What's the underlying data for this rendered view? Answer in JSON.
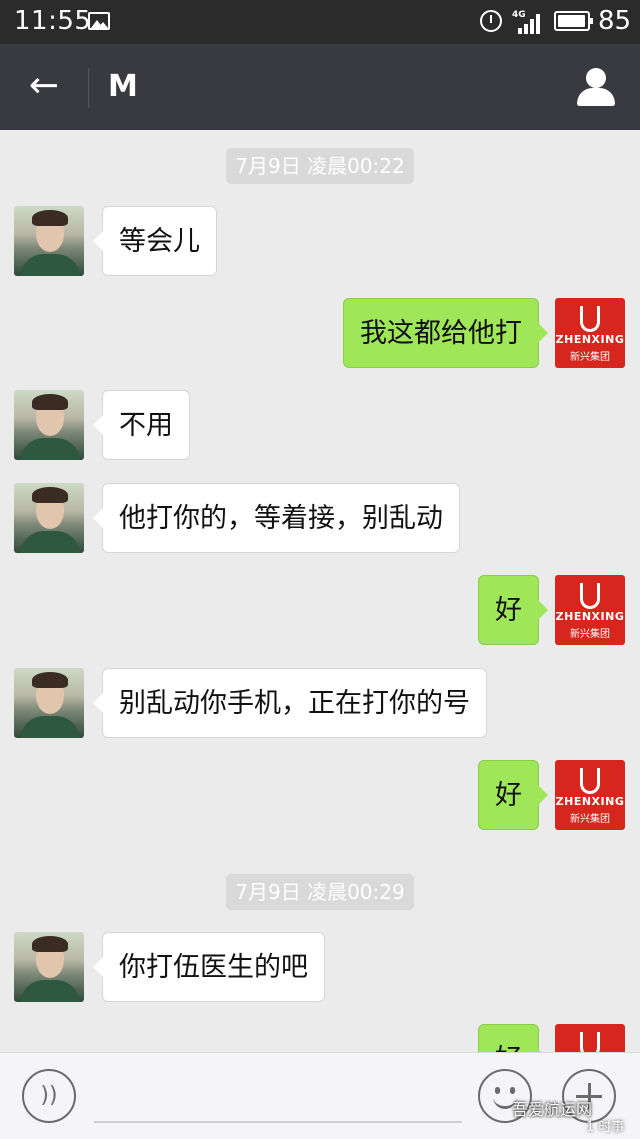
{
  "status_bar": {
    "time": "11:55",
    "network": "4G",
    "battery": "85",
    "battery_level_fraction": 0.85
  },
  "header": {
    "title": "M",
    "back_icon": "arrow-left-icon",
    "profile_icon": "user-profile-icon"
  },
  "chat": {
    "timestamps": [
      "7月9日 凌晨00:22",
      "7月9日 凌晨00:29"
    ],
    "right_avatar": {
      "logo_en": "ZHENXING",
      "logo_cn": "新兴集团"
    },
    "messages": [
      {
        "side": "left",
        "text": "等会儿"
      },
      {
        "side": "right",
        "text": "我这都给他打"
      },
      {
        "side": "left",
        "text": "不用"
      },
      {
        "side": "left",
        "text": "他打你的，等着接，别乱动"
      },
      {
        "side": "right",
        "text": "好"
      },
      {
        "side": "left",
        "text": "别乱动你手机，正在打你的号"
      },
      {
        "side": "right",
        "text": "好"
      },
      {
        "side": "left",
        "text": "你打伍医生的吧"
      },
      {
        "side": "right",
        "text": "好"
      }
    ]
  },
  "input_bar": {
    "voice_icon": "voice-icon",
    "emoji_icon": "emoji-icon",
    "plus_icon": "plus-icon"
  },
  "watermark": {
    "line1": "吾爱航运网",
    "line2": "1 时事"
  },
  "colors": {
    "titlebar": "#393a3f",
    "outgoing_bubble": "#9fe658",
    "incoming_bubble": "#ffffff",
    "background": "#ebebeb",
    "logo_red": "#d7261e"
  }
}
